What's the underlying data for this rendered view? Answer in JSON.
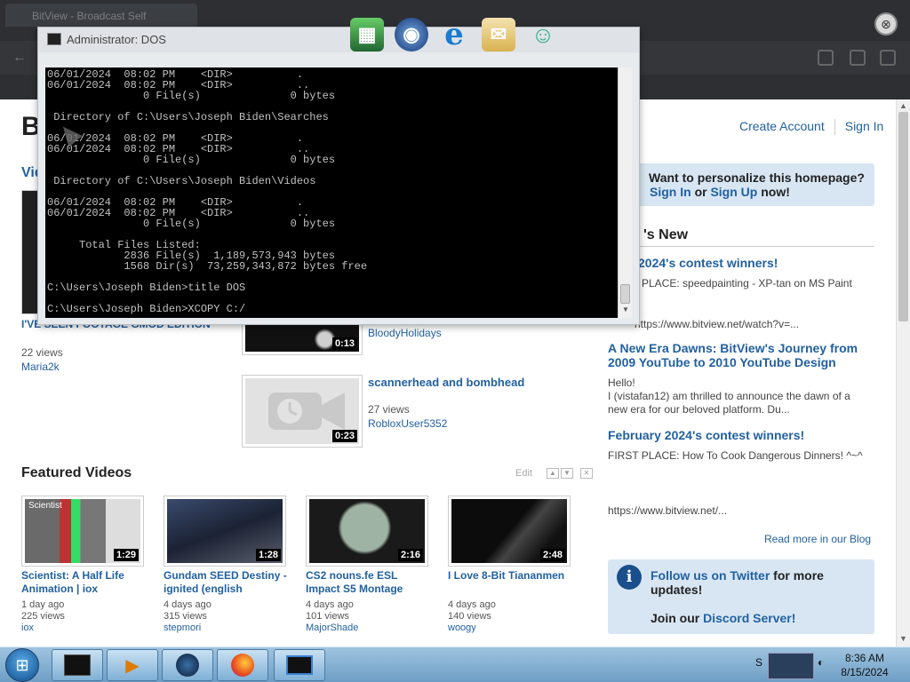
{
  "browser": {
    "tab_title": "BitView - Broadcast Self",
    "close_glyph": "⊗"
  },
  "dock": {
    "items": [
      {
        "name": "winamp-icon"
      },
      {
        "name": "internet-icon"
      },
      {
        "name": "ie-icon"
      },
      {
        "name": "mail-icon"
      },
      {
        "name": "users-icon"
      }
    ]
  },
  "page": {
    "logo_fragment": "Bi",
    "recent_fragment": "Vid",
    "header_links": {
      "create_account": "Create Account",
      "sign_in": "Sign In"
    },
    "personalize": {
      "question": "Want to personalize this homepage?",
      "sign_in": "Sign In",
      "or": "or",
      "sign_up": "Sign Up",
      "now": "now!"
    },
    "news": {
      "heading": "'s New",
      "items": [
        {
          "title": "2024's contest winners!",
          "text": "PLACE: speedpainting - XP-tan on MS Paint",
          "url": "https://www.bitview.net/watch?v=..."
        },
        {
          "title": "A New Era Dawns: BitView's Journey from 2009 YouTube to 2010 YouTube Design",
          "text": "Hello!\nI (vistafan12) am thrilled to announce the dawn of a new era for our beloved platform. Du..."
        },
        {
          "title": "February 2024's contest winners!",
          "text": "FIRST PLACE: How To Cook Dangerous Dinners! ^~^",
          "url": "https://www.bitview.net/..."
        }
      ],
      "read_more": "Read more in our Blog"
    },
    "twitter": {
      "follow": "Follow us on Twitter",
      "for_more": " for more updates!",
      "join": "Join our ",
      "discord": "Discord Server!"
    },
    "left_video": {
      "title": "I'VE SEEN FOOTAGE GMOD EDITION",
      "views": "22 views",
      "user": "Maria2k"
    },
    "mid_videos": [
      {
        "title": "",
        "views": "",
        "user": "BloodyHolidays",
        "duration": "0:13"
      },
      {
        "title": "scannerhead and bombhead",
        "views": "27 views",
        "user": "RobloxUser5352",
        "duration": "0:23"
      }
    ],
    "featured": {
      "heading": "Featured Videos",
      "edit": "Edit",
      "videos": [
        {
          "title": "Scientist: A Half Life Animation | iox",
          "age": "1 day ago",
          "views": "225 views",
          "user": "iox",
          "duration": "1:29",
          "thumb_label": "Scientist"
        },
        {
          "title": "Gundam SEED Destiny - ignited (english",
          "age": "4 days ago",
          "views": "315 views",
          "user": "stepmori",
          "duration": "1:28"
        },
        {
          "title": "CS2 nouns.fe ESL Impact S5 Montage",
          "age": "4 days ago",
          "views": "101 views",
          "user": "MajorShade",
          "duration": "2:16"
        },
        {
          "title": "I Love 8-Bit Tiananmen",
          "age": "4 days ago",
          "views": "140 views",
          "user": "woogy",
          "duration": "2:48"
        }
      ]
    }
  },
  "cmd": {
    "title": "Administrator: DOS",
    "lines": [
      "06/01/2024  08:02 PM    <DIR>          .",
      "06/01/2024  08:02 PM    <DIR>          ..",
      "               0 File(s)              0 bytes",
      "",
      " Directory of C:\\Users\\Joseph Biden\\Searches",
      "",
      "06/01/2024  08:02 PM    <DIR>          .",
      "06/01/2024  08:02 PM    <DIR>          ..",
      "               0 File(s)              0 bytes",
      "",
      " Directory of C:\\Users\\Joseph Biden\\Videos",
      "",
      "06/01/2024  08:02 PM    <DIR>          .",
      "06/01/2024  08:02 PM    <DIR>          ..",
      "               0 File(s)              0 bytes",
      "",
      "     Total Files Listed:",
      "            2836 File(s)  1,189,573,943 bytes",
      "            1568 Dir(s)  73,259,343,872 bytes free",
      "",
      "C:\\Users\\Joseph Biden>title DOS",
      "",
      "C:\\Users\\Joseph Biden>XCOPY C:/"
    ]
  },
  "taskbar": {
    "clock_time": "8:36 AM",
    "clock_date": "8/15/2024",
    "tray_label": "S"
  }
}
